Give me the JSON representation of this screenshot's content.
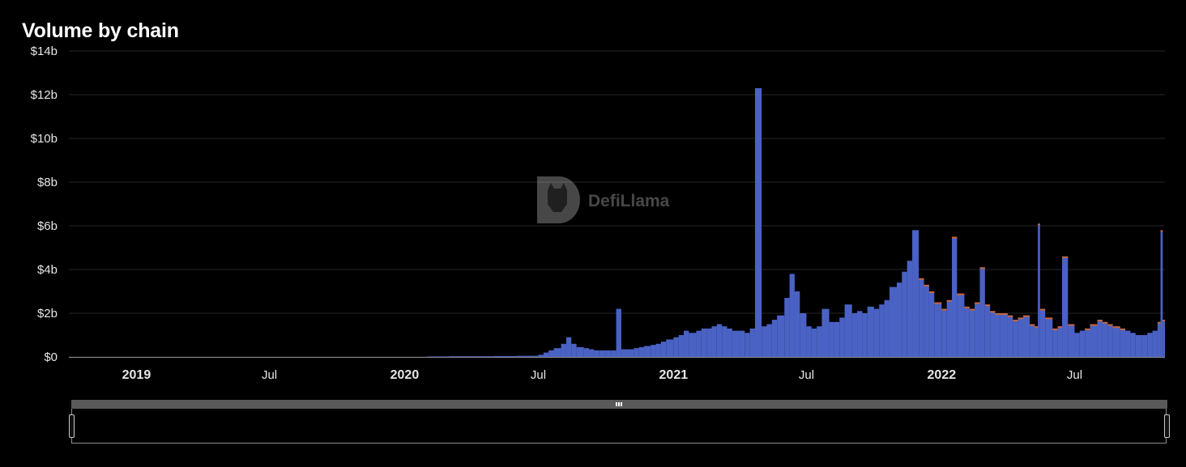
{
  "title": "Volume by chain",
  "watermark": "DefiLlama",
  "colors": {
    "background": "#000000",
    "grid": "#262626",
    "bar": "#4a62c4",
    "bar_secondary": "#c8643c",
    "text": "#ffffff"
  },
  "chart_data": {
    "type": "bar",
    "title": "Volume by chain",
    "xlabel": "",
    "ylabel": "",
    "ylim": [
      0,
      14
    ],
    "y_unit": "$ billions",
    "xlim": [
      "2018-10-01",
      "2022-11-01"
    ],
    "y_ticks": [
      "$0",
      "$2b",
      "$4b",
      "$6b",
      "$8b",
      "$10b",
      "$12b",
      "$14b"
    ],
    "x_ticks": [
      {
        "label": "2019",
        "date": "2019-01-01",
        "major": true
      },
      {
        "label": "Jul",
        "date": "2019-07-01",
        "major": false
      },
      {
        "label": "2020",
        "date": "2020-01-01",
        "major": true
      },
      {
        "label": "Jul",
        "date": "2020-07-01",
        "major": false
      },
      {
        "label": "2021",
        "date": "2021-01-01",
        "major": true
      },
      {
        "label": "Jul",
        "date": "2021-07-01",
        "major": false
      },
      {
        "label": "2022",
        "date": "2022-01-01",
        "major": true
      },
      {
        "label": "Jul",
        "date": "2022-07-01",
        "major": false
      }
    ],
    "grid": true,
    "legend": "none",
    "x": [
      "2020-02-01",
      "2020-03-01",
      "2020-04-01",
      "2020-05-01",
      "2020-06-01",
      "2020-06-15",
      "2020-07-01",
      "2020-07-08",
      "2020-07-15",
      "2020-07-22",
      "2020-08-01",
      "2020-08-08",
      "2020-08-15",
      "2020-08-22",
      "2020-09-01",
      "2020-09-08",
      "2020-09-15",
      "2020-09-22",
      "2020-10-01",
      "2020-10-08",
      "2020-10-15",
      "2020-10-22",
      "2020-11-01",
      "2020-11-08",
      "2020-11-15",
      "2020-11-22",
      "2020-12-01",
      "2020-12-08",
      "2020-12-15",
      "2020-12-22",
      "2021-01-01",
      "2021-01-08",
      "2021-01-15",
      "2021-01-22",
      "2021-02-01",
      "2021-02-08",
      "2021-02-15",
      "2021-02-22",
      "2021-03-01",
      "2021-03-08",
      "2021-03-15",
      "2021-03-22",
      "2021-04-01",
      "2021-04-08",
      "2021-04-15",
      "2021-04-22",
      "2021-05-01",
      "2021-05-08",
      "2021-05-15",
      "2021-05-22",
      "2021-06-01",
      "2021-06-08",
      "2021-06-15",
      "2021-06-22",
      "2021-07-01",
      "2021-07-08",
      "2021-07-15",
      "2021-07-22",
      "2021-08-01",
      "2021-08-08",
      "2021-08-15",
      "2021-08-22",
      "2021-09-01",
      "2021-09-08",
      "2021-09-15",
      "2021-09-22",
      "2021-10-01",
      "2021-10-08",
      "2021-10-15",
      "2021-10-22",
      "2021-11-01",
      "2021-11-08",
      "2021-11-15",
      "2021-11-22",
      "2021-12-01",
      "2021-12-08",
      "2021-12-15",
      "2021-12-22",
      "2022-01-01",
      "2022-01-08",
      "2022-01-15",
      "2022-01-22",
      "2022-02-01",
      "2022-02-08",
      "2022-02-15",
      "2022-02-22",
      "2022-03-01",
      "2022-03-08",
      "2022-03-15",
      "2022-03-22",
      "2022-04-01",
      "2022-04-08",
      "2022-04-15",
      "2022-04-22",
      "2022-05-01",
      "2022-05-08",
      "2022-05-12",
      "2022-05-15",
      "2022-05-22",
      "2022-06-01",
      "2022-06-08",
      "2022-06-14",
      "2022-06-22",
      "2022-07-01",
      "2022-07-08",
      "2022-07-15",
      "2022-07-22",
      "2022-08-01",
      "2022-08-08",
      "2022-08-15",
      "2022-08-22",
      "2022-09-01",
      "2022-09-08",
      "2022-09-15",
      "2022-09-22",
      "2022-10-01",
      "2022-10-08",
      "2022-10-15",
      "2022-10-22",
      "2022-10-26",
      "2022-10-29"
    ],
    "values": [
      0.02,
      0.03,
      0.03,
      0.04,
      0.05,
      0.05,
      0.1,
      0.2,
      0.3,
      0.4,
      0.6,
      0.9,
      0.6,
      0.45,
      0.4,
      0.35,
      0.3,
      0.3,
      0.3,
      0.3,
      2.2,
      0.35,
      0.35,
      0.4,
      0.45,
      0.5,
      0.55,
      0.6,
      0.7,
      0.8,
      0.9,
      1.0,
      1.2,
      1.1,
      1.2,
      1.3,
      1.3,
      1.4,
      1.5,
      1.4,
      1.3,
      1.2,
      1.2,
      1.1,
      1.3,
      12.3,
      1.4,
      1.5,
      1.7,
      1.9,
      2.7,
      3.8,
      3.0,
      2.0,
      1.4,
      1.3,
      1.4,
      2.2,
      1.6,
      1.6,
      1.8,
      2.4,
      2.0,
      2.1,
      2.0,
      2.3,
      2.2,
      2.4,
      2.6,
      3.2,
      3.4,
      3.9,
      4.4,
      5.8,
      3.6,
      3.3,
      3.0,
      2.5,
      2.2,
      2.6,
      5.5,
      2.9,
      2.3,
      2.2,
      2.5,
      4.1,
      2.4,
      2.1,
      2.0,
      2.0,
      1.9,
      1.7,
      1.8,
      1.9,
      1.5,
      1.4,
      6.1,
      2.2,
      1.8,
      1.3,
      1.4,
      4.6,
      1.5,
      1.1,
      1.2,
      1.3,
      1.5,
      1.7,
      1.6,
      1.5,
      1.4,
      1.3,
      1.2,
      1.1,
      1.0,
      1.0,
      1.1,
      1.2,
      1.6,
      5.8,
      1.7
    ]
  }
}
